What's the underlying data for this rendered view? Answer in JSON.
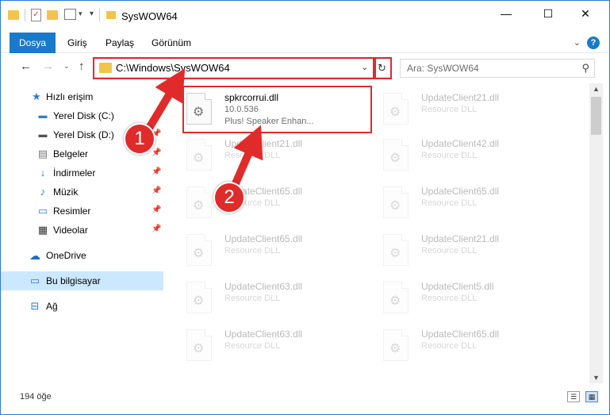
{
  "window": {
    "title": "SysWOW64",
    "minimize": "—",
    "maximize": "☐",
    "close": "✕"
  },
  "ribbon": {
    "tabs": [
      "Dosya",
      "Giriş",
      "Paylaş",
      "Görünüm"
    ],
    "expand_icon": "chevron-down-icon",
    "help_label": "?"
  },
  "address": {
    "path": "C:\\Windows\\SysWOW64",
    "search_placeholder": "Ara: SysWOW64"
  },
  "sidebar": {
    "quick_access": "Hızlı erişim",
    "items": [
      {
        "label": "Yerel Disk (C:)",
        "icon": "drive-icon",
        "pinned": true
      },
      {
        "label": "Yerel Disk (D:)",
        "icon": "drive-icon",
        "pinned": true
      },
      {
        "label": "Belgeler",
        "icon": "documents-icon",
        "pinned": true
      },
      {
        "label": "İndirmeler",
        "icon": "downloads-icon",
        "pinned": true
      },
      {
        "label": "Müzik",
        "icon": "music-icon",
        "pinned": true
      },
      {
        "label": "Resimler",
        "icon": "pictures-icon",
        "pinned": true
      },
      {
        "label": "Videolar",
        "icon": "videos-icon",
        "pinned": true
      }
    ],
    "onedrive": "OneDrive",
    "this_pc": "Bu bilgisayar",
    "network": "Ağ"
  },
  "files": {
    "highlighted": {
      "name": "spkrcorrui.dll",
      "version": "10.0.536",
      "description": "Plus! Speaker Enhan..."
    },
    "faded": [
      {
        "name": "UpdateClient21.dll",
        "type": "Resource DLL"
      },
      {
        "name": "UpdateClient21.dll",
        "type": "Resource DLL"
      },
      {
        "name": "UpdateClient42.dll",
        "type": "Resource DLL"
      },
      {
        "name": "UpdateClient65.dll",
        "type": "Resource DLL"
      },
      {
        "name": "UpdateClient65.dll",
        "type": "Resource DLL"
      },
      {
        "name": "UpdateClient65.dll",
        "type": "Resource DLL"
      },
      {
        "name": "UpdateClient21.dll",
        "type": "Resource DLL"
      },
      {
        "name": "UpdateClient63.dll",
        "type": "Resource DLL"
      },
      {
        "name": "UpdateClient5.dll",
        "type": "Resource DLL"
      },
      {
        "name": "UpdateClient63.dll",
        "type": "Resource DLL"
      },
      {
        "name": "UpdateClient65.dll",
        "type": "Resource DLL"
      }
    ]
  },
  "status": {
    "item_count": "194 öğe"
  },
  "annotations": {
    "step1": "1",
    "step2": "2",
    "accent": "#e02b2b"
  }
}
